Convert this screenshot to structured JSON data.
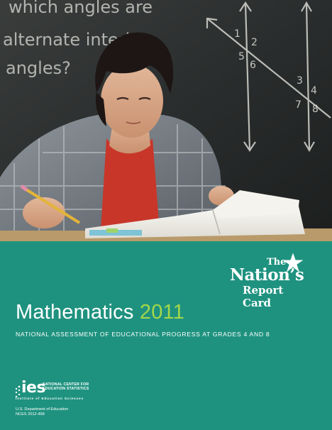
{
  "photo": {
    "chalkboard_text": [
      "which angles are",
      "alternate interior",
      "angles?"
    ],
    "angle_labels": [
      "1",
      "2",
      "5",
      "6",
      "3",
      "4",
      "7",
      "8"
    ]
  },
  "logo": {
    "line1": "The",
    "line2": "Nation’s",
    "line3": "Report Card"
  },
  "title": {
    "subject": "Mathematics",
    "year": "2011"
  },
  "subtitle": "NATIONAL ASSESSMENT OF EDUCATIONAL PROGRESS AT GRADES 4 AND 8",
  "ies": {
    "mark": "ies",
    "center_line1": "NATIONAL CENTER FOR",
    "center_line2": "EDUCATION STATISTICS",
    "institute": "Institute of Education Sciences"
  },
  "dept": {
    "line1": "U.S. Department of Education",
    "line2": "NCES 2012-458"
  },
  "colors": {
    "band": "#1e927f",
    "year_accent": "#a4d64a",
    "chalkboard": "#2b2f2f",
    "shirt_red": "#c8362a"
  }
}
